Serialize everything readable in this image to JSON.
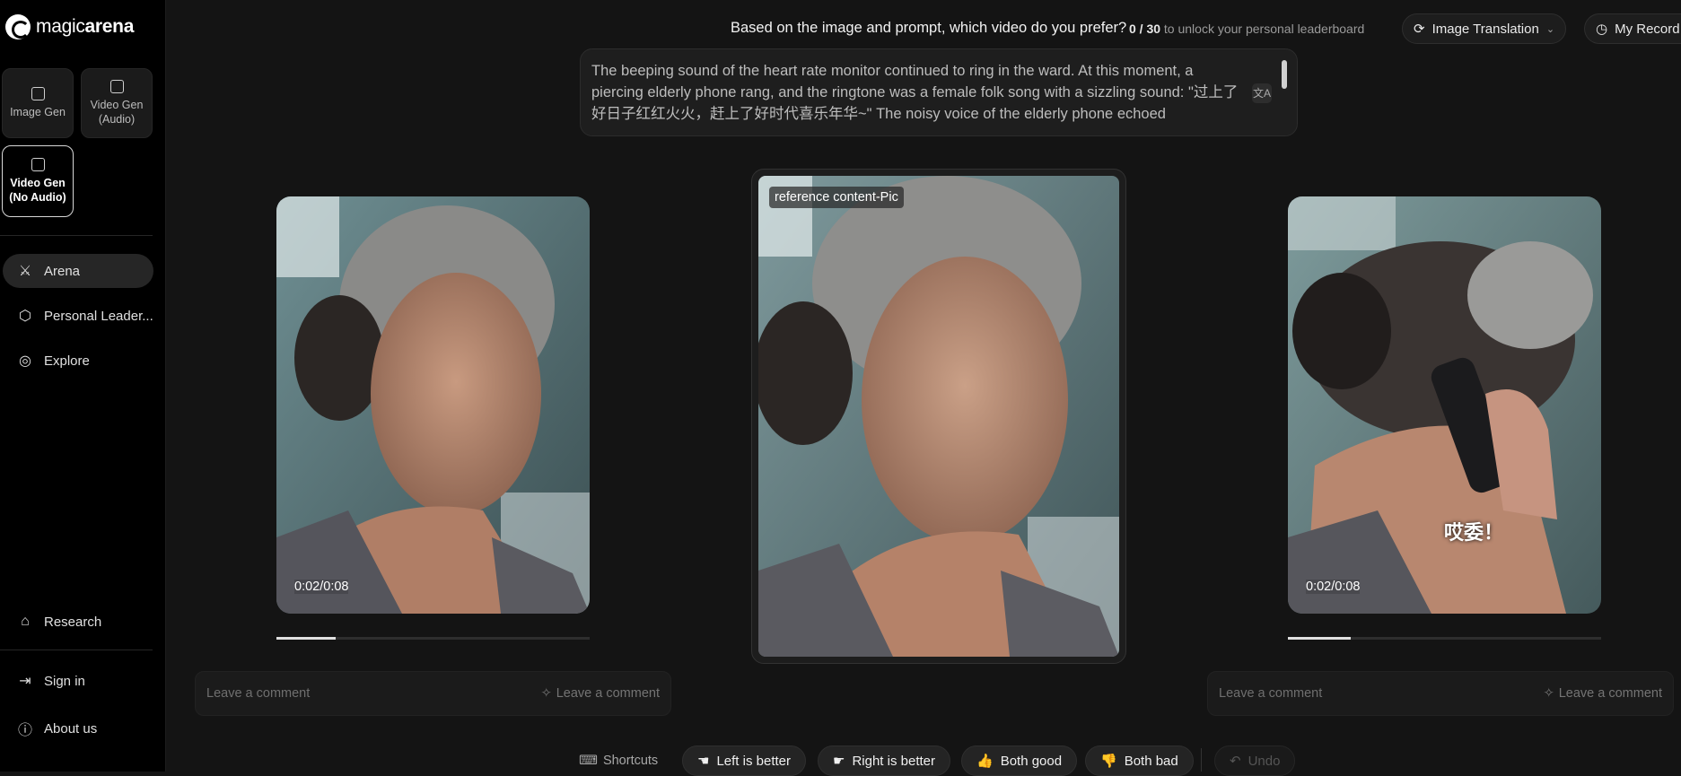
{
  "brand": {
    "light": "magic",
    "bold": "arena"
  },
  "modes": [
    {
      "label": "Image Gen",
      "icon": "image-icon"
    },
    {
      "label": "Video Gen\n(Audio)",
      "icon": "video-audio-icon"
    },
    {
      "label": "Video Gen\n(No Audio)",
      "icon": "video-play-icon",
      "active": true
    }
  ],
  "nav": {
    "arena": "Arena",
    "leaderboard": "Personal Leader...",
    "explore": "Explore",
    "research": "Research",
    "signin": "Sign in",
    "about": "About us"
  },
  "header": {
    "question": "Based on the image and prompt, which video do you prefer?",
    "progress_count": "0 / 30",
    "progress_suffix": "to unlock your personal leaderboard",
    "translation": "Image Translation",
    "record": "My Record"
  },
  "prompt": {
    "text": "The beeping sound of the heart rate monitor continued to ring in the ward. At this moment, a piercing elderly phone rang, and the ringtone was a female folk song with a sizzling sound: \"过上了好日子红红火火，赶上了好时代喜乐年华~\" The noisy voice of the elderly phone echoed"
  },
  "left_video": {
    "time": "0:02/0:08",
    "progress": 0.19
  },
  "right_video": {
    "time": "0:02/0:08",
    "progress": 0.2,
    "caption": "哎委！"
  },
  "reference": {
    "tag": "reference content-Pic"
  },
  "comments": {
    "left_placeholder": "Leave a comment",
    "left_ai": "Leave a comment",
    "right_placeholder": "Leave a comment",
    "right_ai": "Leave a comment"
  },
  "actions": {
    "shortcuts": "Shortcuts",
    "left_better": "Left is better",
    "right_better": "Right is better",
    "both_good": "Both good",
    "both_bad": "Both bad",
    "undo": "Undo"
  }
}
